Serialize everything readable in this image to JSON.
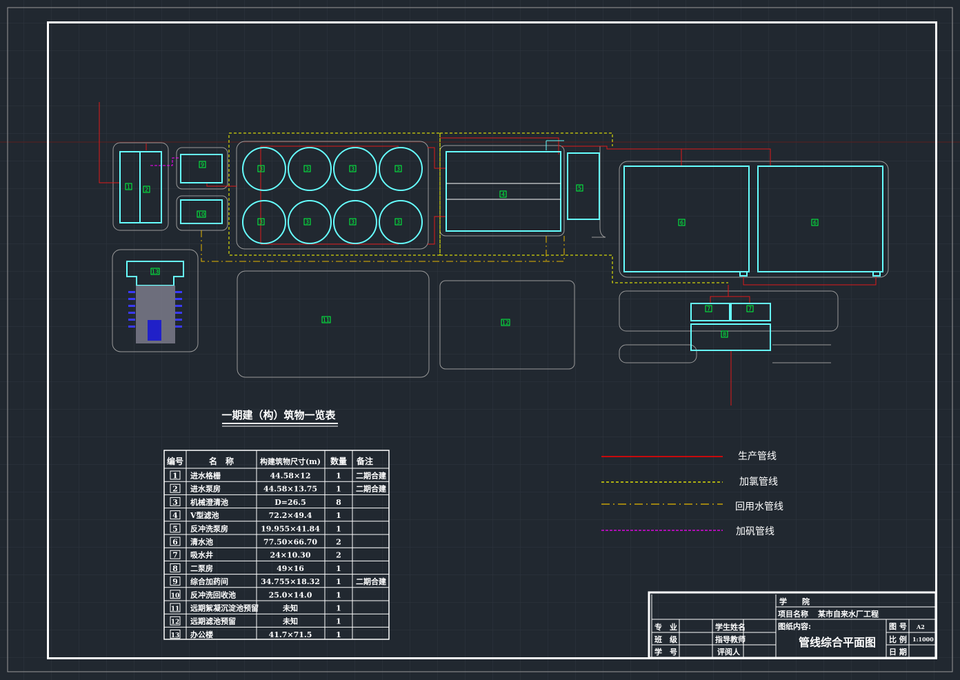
{
  "plan": {
    "building_labels": {
      "b1": "1",
      "b2": "2",
      "b3": "3",
      "b4": "4",
      "b5": "5",
      "b6": "6",
      "b7": "7",
      "b8": "8",
      "b9": "9",
      "b10": "10",
      "b11": "11",
      "b12": "12",
      "b13": "13"
    }
  },
  "table": {
    "title": "一期建（构）筑物一览表",
    "headers": [
      "编号",
      "名　称",
      "构建筑物尺寸(m)",
      "数量",
      "备注"
    ],
    "rows": [
      {
        "no": "1",
        "name": "进水格栅",
        "size": "44.58×12",
        "qty": "1",
        "note": "二期合建"
      },
      {
        "no": "2",
        "name": "进水泵房",
        "size": "44.58×13.75",
        "qty": "1",
        "note": "二期合建"
      },
      {
        "no": "3",
        "name": "机械澄清池",
        "size": "D=26.5",
        "qty": "8",
        "note": ""
      },
      {
        "no": "4",
        "name": "V型滤池",
        "size": "72.2×49.4",
        "qty": "1",
        "note": ""
      },
      {
        "no": "5",
        "name": "反冲洗泵房",
        "size": "19.955×41.84",
        "qty": "1",
        "note": ""
      },
      {
        "no": "6",
        "name": "清水池",
        "size": "77.50×66.70",
        "qty": "2",
        "note": ""
      },
      {
        "no": "7",
        "name": "吸水井",
        "size": "24×10.30",
        "qty": "2",
        "note": ""
      },
      {
        "no": "8",
        "name": "二泵房",
        "size": "49×16",
        "qty": "1",
        "note": ""
      },
      {
        "no": "9",
        "name": "综合加药间",
        "size": "34.755×18.32",
        "qty": "1",
        "note": "二期合建"
      },
      {
        "no": "10",
        "name": "反冲洗回收池",
        "size": "25.0×14.0",
        "qty": "1",
        "note": ""
      },
      {
        "no": "11",
        "name": "远期絮凝沉淀池预留",
        "size": "未知",
        "qty": "1",
        "note": ""
      },
      {
        "no": "12",
        "name": "远期滤池预留",
        "size": "未知",
        "qty": "1",
        "note": ""
      },
      {
        "no": "13",
        "name": "办公楼",
        "size": "41.7×71.5",
        "qty": "1",
        "note": ""
      }
    ]
  },
  "legend": [
    {
      "label": "生产管线",
      "color": "#ff0000"
    },
    {
      "label": "加氯管线",
      "color": "#ffff00"
    },
    {
      "label": "回用水管线",
      "color": "#e6b800"
    },
    {
      "label": "加矾管线",
      "color": "#ff00ff"
    }
  ],
  "title_block": {
    "school_label": "学　　院",
    "project_label": "项目名称",
    "project_name": "某市自来水厂工程",
    "content_label": "图纸内容:",
    "drawing_title": "管线综合平面图",
    "major_label": "专　业",
    "class_label": "班　级",
    "student_id_label": "学　号",
    "student_name_label": "学生姓名",
    "teacher_label": "指导教师",
    "reviewer_label": "评阅人",
    "sheet_label": "图 号",
    "sheet_value": "A2",
    "scale_label": "比 例",
    "scale_value": "1:1000",
    "date_label": "日 期"
  },
  "colors": {
    "background": "#212830",
    "grid": "#2e3640",
    "frame": "#ffffff",
    "structure": "#66ffff",
    "outline": "#9a9a9a",
    "label": "#00ff40"
  }
}
